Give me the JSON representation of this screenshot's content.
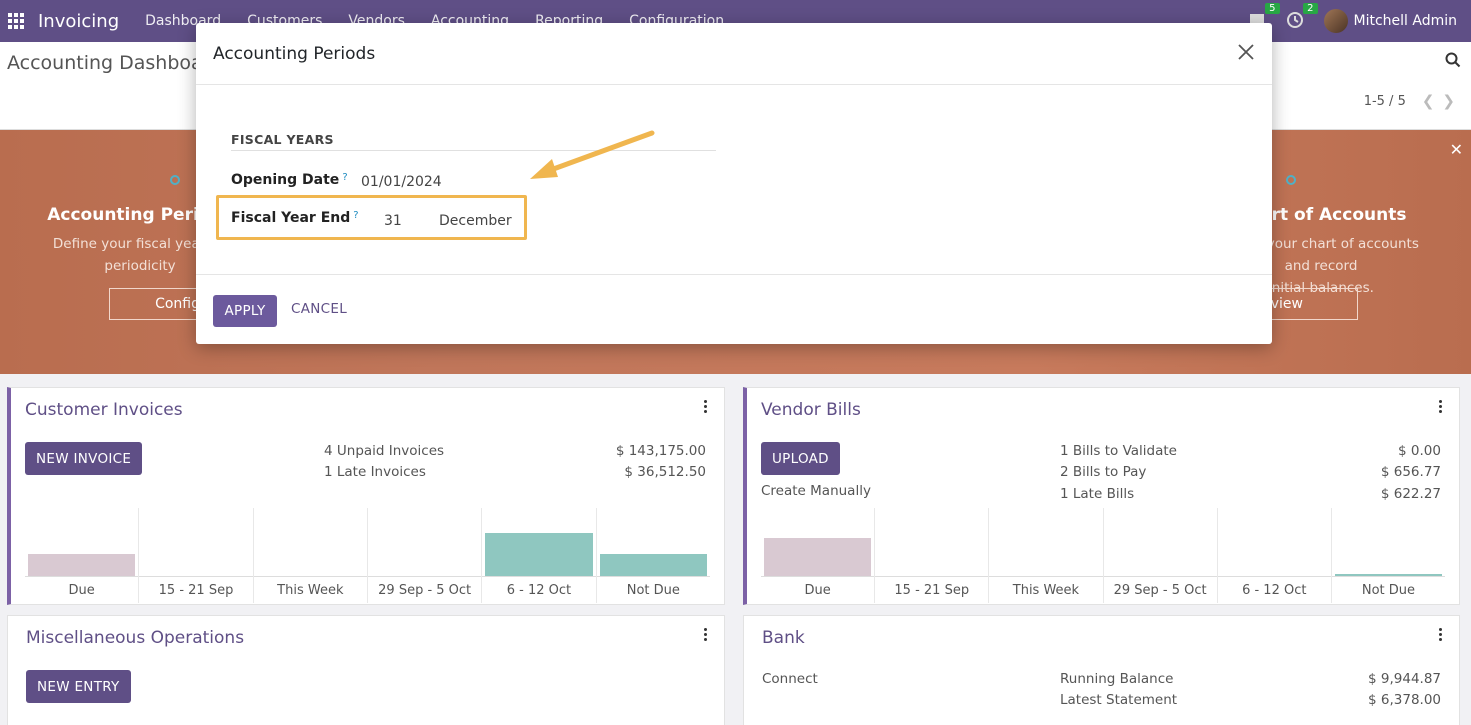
{
  "navbar": {
    "brand": "Invoicing",
    "menu": [
      "Dashboard",
      "Customers",
      "Vendors",
      "Accounting",
      "Reporting",
      "Configuration"
    ],
    "messages_badge": "5",
    "activities_badge": "2",
    "user_name": "Mitchell Admin"
  },
  "control_panel": {
    "title": "Accounting Dashboard",
    "pager": "1-5 / 5"
  },
  "banner": {
    "left_title": "Accounting Periods",
    "left_sub_1": "Define your fiscal years &",
    "left_sub_2": "periodicity",
    "left_button": "Configure",
    "right_title": "Chart of Accounts",
    "right_sub_1": "Setup your chart of accounts and record",
    "right_sub_2": "initial balances.",
    "right_button": "Review"
  },
  "cards": {
    "customer_invoices": {
      "title": "Customer Invoices",
      "button": "NEW INVOICE",
      "stats": [
        {
          "label": "4 Unpaid Invoices",
          "value": "$ 143,175.00"
        },
        {
          "label": "1 Late Invoices",
          "value": "$ 36,512.50"
        }
      ],
      "graph_labels": [
        "Due",
        "15 - 21 Sep",
        "This Week",
        "29 Sep - 5 Oct",
        "6 - 12 Oct",
        "Not Due"
      ]
    },
    "vendor_bills": {
      "title": "Vendor Bills",
      "button": "UPLOAD",
      "create_manually": "Create Manually",
      "stats": [
        {
          "label": "1 Bills to Validate",
          "value": "$ 0.00"
        },
        {
          "label": "2 Bills to Pay",
          "value": "$ 656.77"
        },
        {
          "label": "1 Late Bills",
          "value": "$ 622.27"
        }
      ],
      "graph_labels": [
        "Due",
        "15 - 21 Sep",
        "This Week",
        "29 Sep - 5 Oct",
        "6 - 12 Oct",
        "Not Due"
      ]
    },
    "misc_operations": {
      "title": "Miscellaneous Operations",
      "button": "NEW ENTRY"
    },
    "bank": {
      "title": "Bank",
      "connect": "Connect",
      "stats": [
        {
          "label": "Running Balance",
          "value": "$ 9,944.87"
        },
        {
          "label": "Latest Statement",
          "value": "$ 6,378.00"
        }
      ]
    }
  },
  "modal": {
    "title": "Accounting Periods",
    "section": "FISCAL YEARS",
    "opening_date_label": "Opening Date",
    "opening_date_value": "01/01/2024",
    "fiscal_year_end_label": "Fiscal Year End",
    "fiscal_year_end_day": "31",
    "fiscal_year_end_month": "December",
    "help_mark": "?",
    "apply": "APPLY",
    "cancel": "CANCEL"
  },
  "colors": {
    "navbar": "#5f4f86",
    "accent": "#7c61a6",
    "banner": "#c0765a",
    "highlight": "#f0b64f",
    "bar_pink": "#d9c9d2",
    "bar_teal": "#8fc7c0"
  }
}
